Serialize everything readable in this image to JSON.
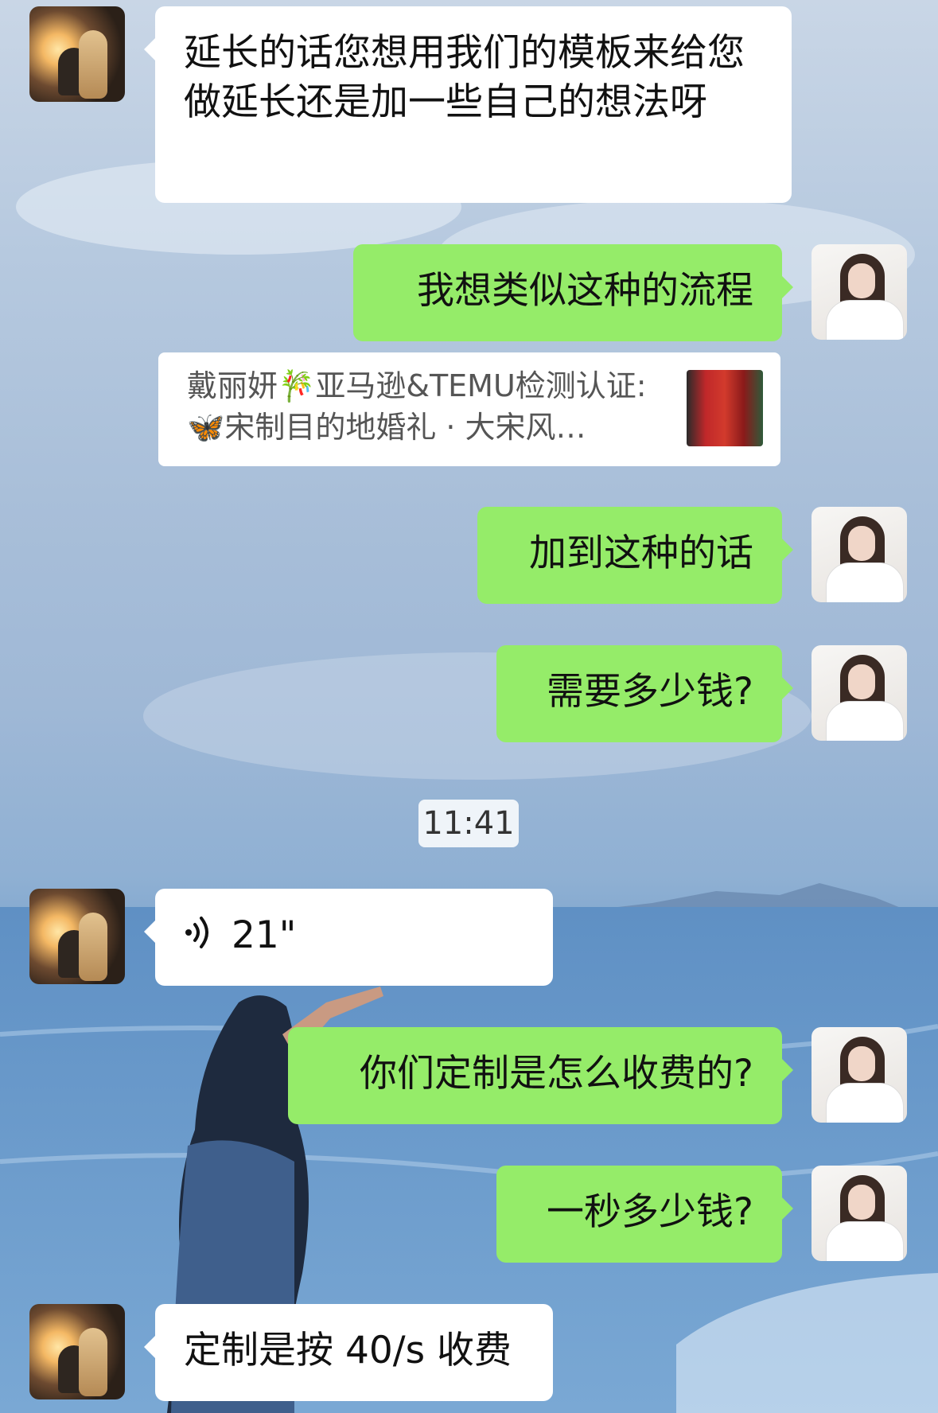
{
  "messages": [
    {
      "side": "left",
      "type": "text",
      "text": "延长的话您想用我们的模板来给您做延长还是加一些自己的想法呀"
    },
    {
      "side": "right",
      "type": "text",
      "text": "我想类似这种的流程"
    },
    {
      "side": "right",
      "type": "quote",
      "text": "戴丽妍🎋亚马逊&TEMU检测认证: 🦋宋制目的地婚礼 · 大宋风…"
    },
    {
      "side": "right",
      "type": "text",
      "text": "加到这种的话"
    },
    {
      "side": "right",
      "type": "text",
      "text": "需要多少钱?"
    },
    {
      "side": "center",
      "type": "timestamp",
      "text": "11:41"
    },
    {
      "side": "left",
      "type": "voice",
      "text": "21\""
    },
    {
      "side": "right",
      "type": "text",
      "text": "你们定制是怎么收费的?"
    },
    {
      "side": "right",
      "type": "text",
      "text": "一秒多少钱?"
    },
    {
      "side": "left",
      "type": "text",
      "text": "定制是按 40/s 收费"
    }
  ],
  "colors": {
    "green_bubble": "#95ec69",
    "white_bubble": "#ffffff"
  },
  "icons": {
    "voice": "voice-wave-icon"
  }
}
